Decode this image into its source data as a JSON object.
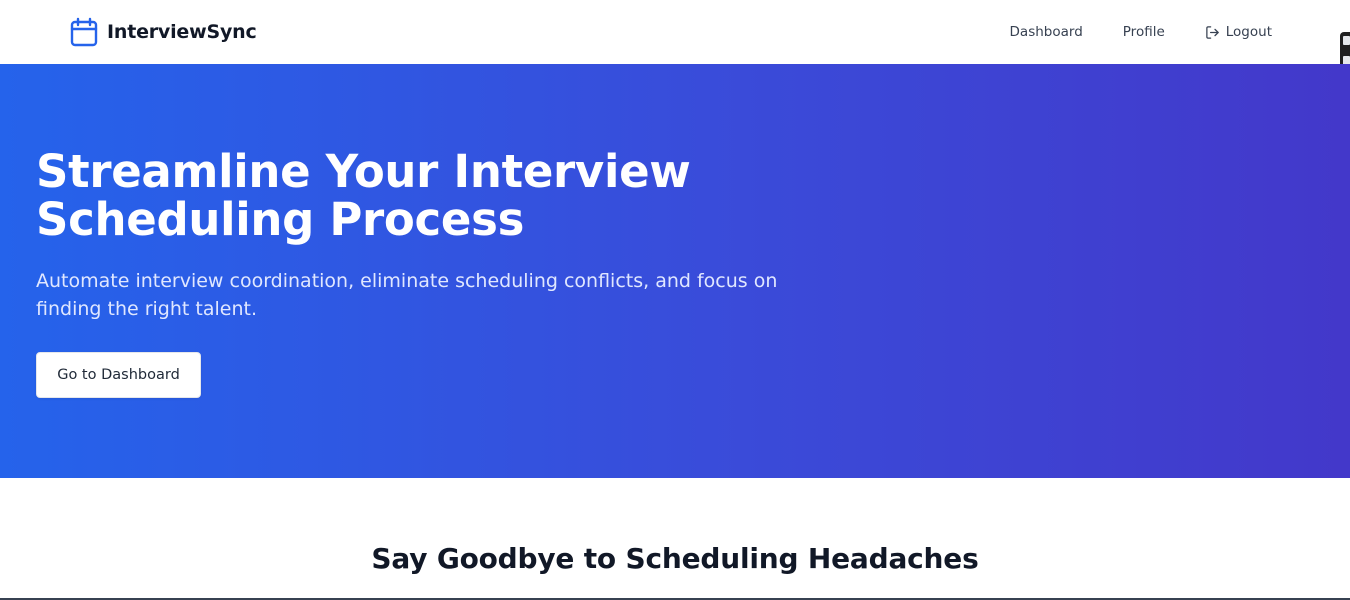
{
  "header": {
    "brand_name": "InterviewSync",
    "brand_icon": "calendar-icon",
    "nav": {
      "dashboard": "Dashboard",
      "profile": "Profile",
      "logout": "Logout"
    },
    "logout_icon": "logout-icon"
  },
  "hero": {
    "title_line1": "Streamline Your Interview",
    "title_line2": "Scheduling Process",
    "subtitle": "Automate interview coordination, eliminate scheduling conflicts, and focus on finding the right talent.",
    "cta_label": "Go to Dashboard"
  },
  "features": {
    "heading": "Say Goodbye to Scheduling Headaches"
  },
  "colors": {
    "brand_accent": "#2563eb",
    "hero_gradient_start": "#2563eb",
    "hero_gradient_end": "#4338ca"
  }
}
